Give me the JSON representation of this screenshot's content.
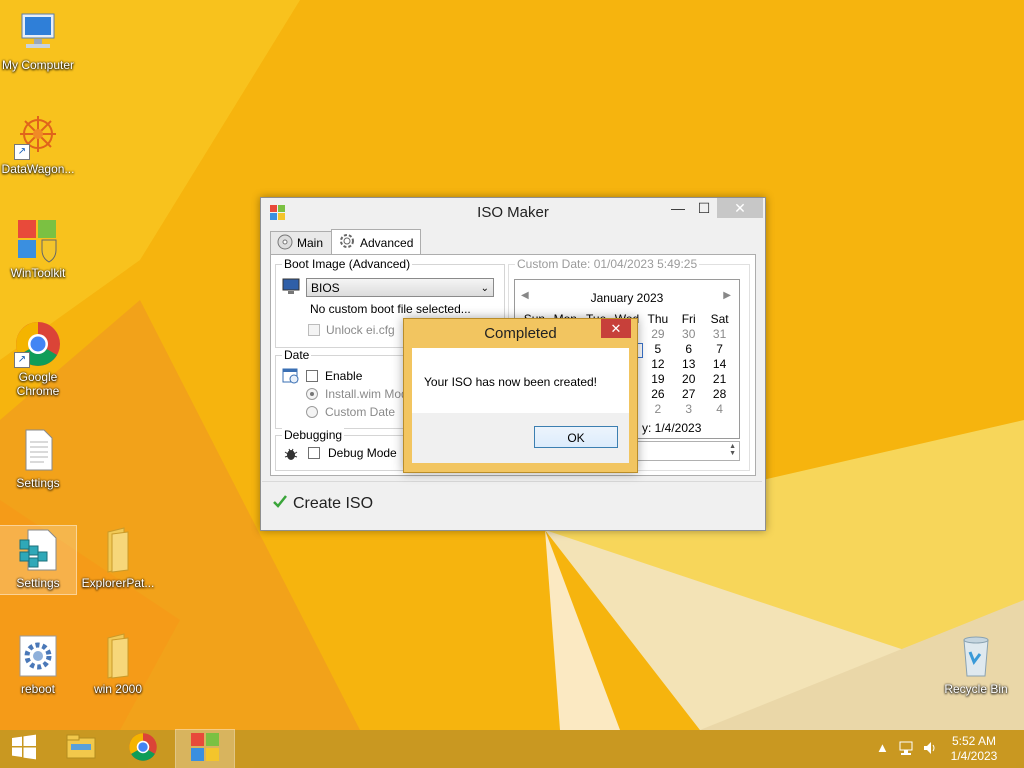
{
  "desktop": {
    "icons": [
      {
        "label": "My Computer"
      },
      {
        "label": "DataWagon..."
      },
      {
        "label": "WinToolkit"
      },
      {
        "label": "Google Chrome"
      },
      {
        "label": "Settings"
      },
      {
        "label": "Settings"
      },
      {
        "label": "ExplorerPat..."
      },
      {
        "label": "reboot"
      },
      {
        "label": "win 2000"
      },
      {
        "label": "Recycle Bin"
      }
    ]
  },
  "window": {
    "title": "ISO Maker",
    "tabs": [
      {
        "label": "Main"
      },
      {
        "label": "Advanced"
      }
    ],
    "boot_image": {
      "legend": "Boot Image (Advanced)",
      "select_value": "BIOS",
      "status": "No custom boot file selected...",
      "unlock_label": "Unlock ei.cfg"
    },
    "date": {
      "legend": "Date",
      "enable_label": "Enable",
      "install_label": "Install.wim Modifi",
      "custom_label": "Custom Date"
    },
    "custom_date": {
      "legend": "Custom Date: 01/04/2023 5:49:25",
      "month_label": "January 2023",
      "weekdays": [
        "Sun",
        "Mon",
        "Tue",
        "Wed",
        "Thu",
        "Fri",
        "Sat"
      ],
      "visible_days": [
        [
          "29",
          "30",
          "31"
        ],
        [
          "5",
          "6",
          "7"
        ],
        [
          "12",
          "13",
          "14"
        ],
        [
          "19",
          "20",
          "21"
        ],
        [
          "26",
          "27",
          "28"
        ],
        [
          "2",
          "3",
          "4"
        ]
      ],
      "today_text": "y: 1/4/2023"
    },
    "debugging": {
      "legend": "Debugging",
      "debug_label": "Debug Mode"
    },
    "create_label": "Create ISO"
  },
  "dialog": {
    "title": "Completed",
    "message": "Your ISO has now been created!",
    "ok_label": "OK",
    "close_glyph": "✕"
  },
  "taskbar": {
    "time": "5:52 AM",
    "date": "1/4/2023"
  }
}
